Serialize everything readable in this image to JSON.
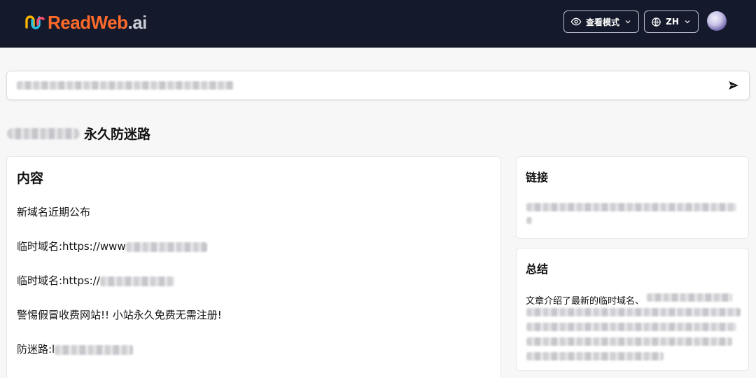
{
  "header": {
    "logo_brand": "ReadWeb",
    "logo_tld": ".ai",
    "view_mode_label": "查看模式",
    "language_label": "ZH"
  },
  "colors": {
    "topbar": "#141a2b",
    "brand_orange": "#ff6a2a"
  },
  "page": {
    "title_suffix": "永久防迷路"
  },
  "content": {
    "heading": "内容",
    "lines": [
      "新域名近期公布",
      "临时域名:https://www",
      "临时域名:https://",
      "警惕假冒收费网站!! 小站永久免费无需注册!",
      "防迷路:l"
    ]
  },
  "links": {
    "heading": "链接"
  },
  "summary": {
    "heading": "总结",
    "text": "文章介绍了最新的临时域名、"
  },
  "icons": {
    "view": "eye-icon",
    "language": "globe-icon",
    "send": "send-icon"
  }
}
